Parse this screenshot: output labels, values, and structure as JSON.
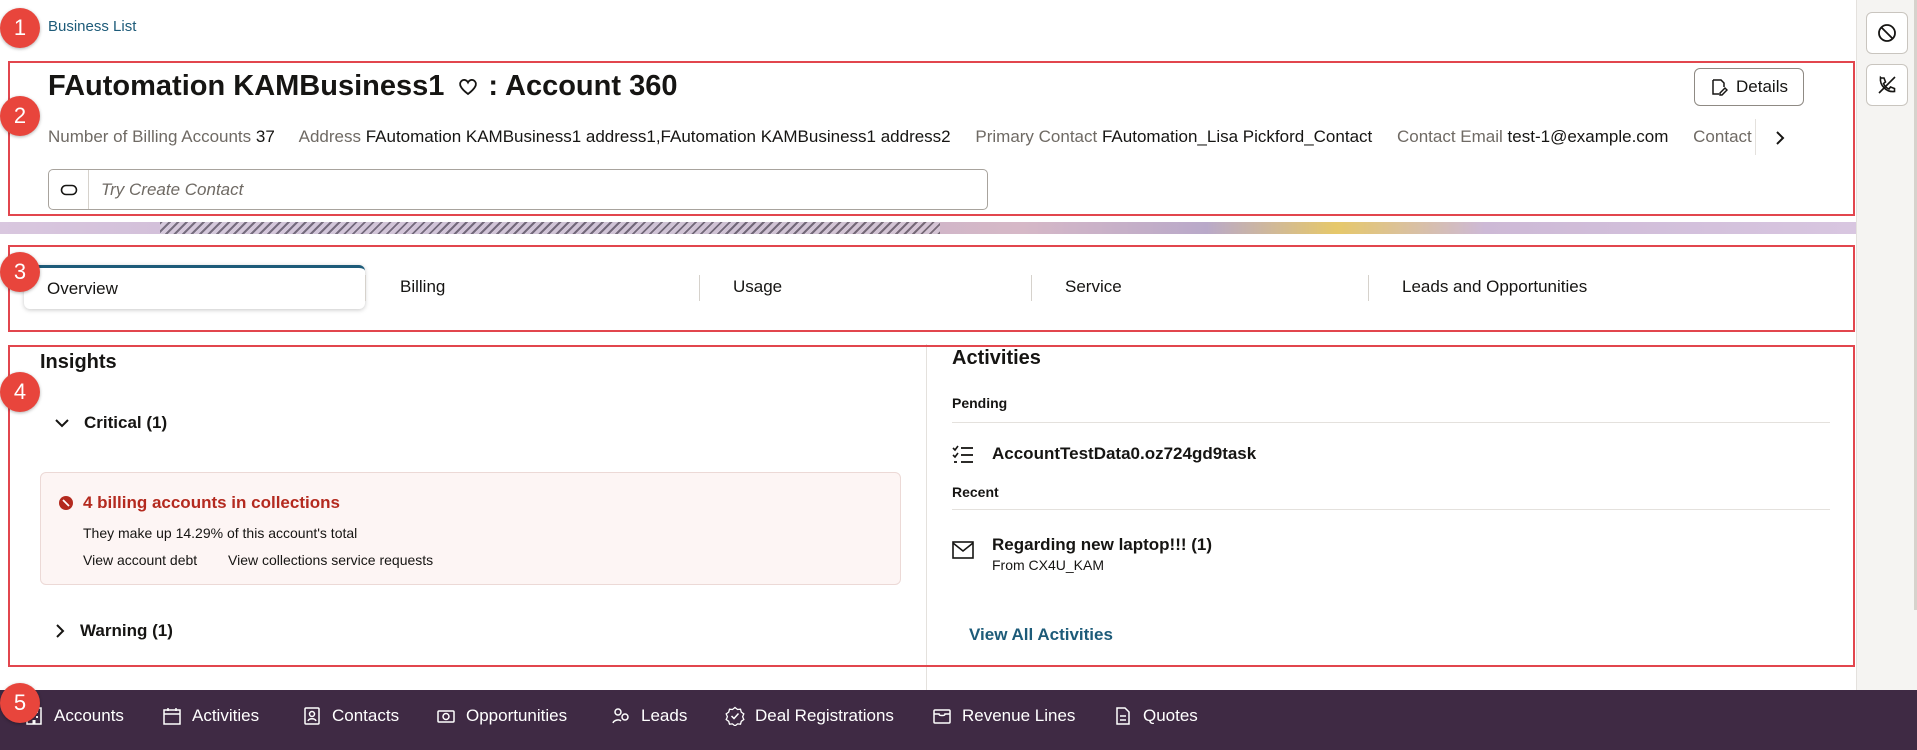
{
  "breadcrumb": {
    "label": "Business List"
  },
  "header": {
    "name": "FAutomation KAMBusiness1",
    "account_suffix": ": Account 360",
    "details_label": "Details",
    "meta": [
      {
        "label": "Number of Billing Accounts",
        "value": "37"
      },
      {
        "label": "Address",
        "value": "FAutomation KAMBusiness1 address1,FAutomation KAMBusiness1 address2"
      },
      {
        "label": "Primary Contact",
        "value": "FAutomation_Lisa Pickford_Contact"
      },
      {
        "label": "Contact Email",
        "value": "test-1@example.com"
      },
      {
        "label": "Contact",
        "value": ""
      }
    ],
    "search_placeholder": "Try Create Contact"
  },
  "tabs": [
    {
      "label": "Overview"
    },
    {
      "label": "Billing"
    },
    {
      "label": "Usage"
    },
    {
      "label": "Service"
    },
    {
      "label": "Leads and Opportunities"
    }
  ],
  "insights": {
    "title": "Insights",
    "critical_label": "Critical (1)",
    "critical_card": {
      "title": "4 billing accounts in collections",
      "subtitle": "They make up 14.29% of this account's total",
      "links": [
        "View account debt",
        "View collections service requests"
      ]
    },
    "warning_label": "Warning (1)"
  },
  "activities": {
    "title": "Activities",
    "pending_label": "Pending",
    "pending_item": "AccountTestData0.oz724gd9task",
    "recent_label": "Recent",
    "recent_item_title": "Regarding new laptop!!! (1)",
    "recent_item_from": "From CX4U_KAM",
    "view_all": "View All Activities"
  },
  "bottom_nav": [
    {
      "label": "Accounts",
      "icon": "building-icon"
    },
    {
      "label": "Activities",
      "icon": "calendar-icon"
    },
    {
      "label": "Contacts",
      "icon": "contact-card-icon"
    },
    {
      "label": "Opportunities",
      "icon": "opportunity-icon"
    },
    {
      "label": "Leads",
      "icon": "leads-icon"
    },
    {
      "label": "Deal Registrations",
      "icon": "badge-check-icon"
    },
    {
      "label": "Revenue Lines",
      "icon": "tray-icon"
    },
    {
      "label": "Quotes",
      "icon": "document-icon"
    }
  ],
  "annotations": [
    "1",
    "2",
    "3",
    "4",
    "5"
  ],
  "colors": {
    "link": "#1d5b79",
    "critical": "#b42a1f",
    "nav_bg": "#3f2a44",
    "annotation": "#e2464e"
  }
}
